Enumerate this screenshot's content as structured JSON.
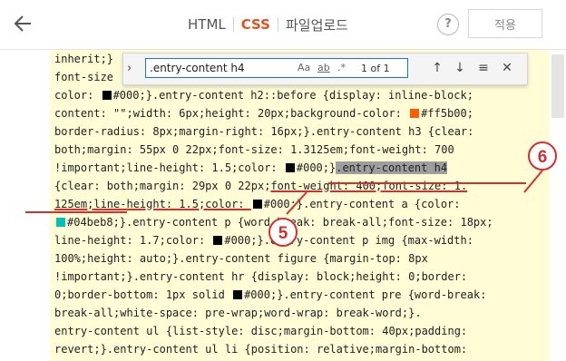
{
  "header": {
    "tabs": [
      {
        "label": "HTML"
      },
      {
        "label": "CSS"
      },
      {
        "label": "파일업로드"
      }
    ],
    "help_label": "?",
    "apply_label": "적용"
  },
  "find": {
    "query": ".entry-content h4",
    "match_case": "Aa",
    "whole_word": "ab",
    "regex": ".*",
    "count": "1 of 1",
    "prev": "↑",
    "next": "↓",
    "selection": "≡",
    "close": "✕"
  },
  "code": {
    "l1": "inherit;}",
    "l2": "font-size",
    "l3a": "color: ",
    "l3b": "#000;}.entry-content h2::before {display: inline-block;",
    "l4": "content: \"\";width: 6px;height: 20px;background-color: ",
    "l4b": "#ff5b00;",
    "l5": "border-radius: 8px;margin-right: 16px;}.entry-content h3 {clear:",
    "l6": "both;margin: 55px 0 22px;font-size: 1.3125em;font-weight: 700",
    "l7a": "!important;line-height: 1.5;color: ",
    "l7b": "#000;}",
    "l7c": ".entry-content h4",
    "l8a": "{clear: both;margin: 29px 0 22px;",
    "l8b": "font-weight: 400;",
    "l8c": "font-size: 1.",
    "l9a": "125em;",
    "l9b": "line-height: 1.5;color: ",
    "l9c": "#000;}.entry-content a {color:",
    "l10a": "#04beb8;}.entry-content p {word-break: break-all;font-size: 18px;",
    "l11a": "line-height: 1.7;color: ",
    "l11b": "#000;}.entry-content p img {max-width:",
    "l12": "100%;height: auto;}.entry-content figure {margin-top: 8px",
    "l13": "!important;}.entry-content hr {display: block;height: 0;border:",
    "l14a": "0;border-bottom: 1px solid ",
    "l14b": "#000;}.entry-content pre {word-break:",
    "l15": "break-all;white-space: pre-wrap;word-wrap: break-word;}.",
    "l16": "entry-content ul {list-style: disc;margin-bottom: 40px;padding:",
    "l17": "revert;}.entry-content ul li {position: relative;margin-bottom:"
  },
  "annotations": {
    "label5": "5",
    "label6": "6",
    "color": "#d32f2f"
  },
  "colors": {
    "accent": "#e4501f",
    "editor_bg": "#fffcd6",
    "swatch_black": "#000000",
    "swatch_orange": "#ff5b00",
    "swatch_teal": "#04beb8"
  }
}
